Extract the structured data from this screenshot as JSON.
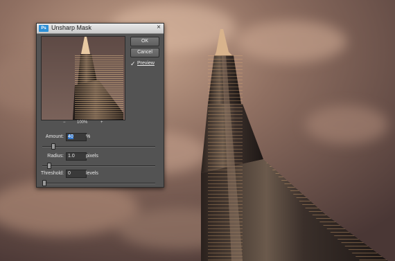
{
  "dialog": {
    "title": "Unsharp Mask",
    "icon_text": "Ps",
    "close_glyph": "×",
    "ok_label": "OK",
    "cancel_label": "Cancel",
    "preview_label": "Preview",
    "preview_checked": true,
    "check_glyph": "✓",
    "zoom_out_glyph": "−",
    "zoom_in_glyph": "+",
    "zoom_level": "100%"
  },
  "fields": {
    "amount": {
      "label": "Amount:",
      "value": "40",
      "unit": "%",
      "slider_fraction": 0.08
    },
    "radius": {
      "label": "Radius:",
      "value": "1.0",
      "unit": "pixels",
      "slider_fraction": 0.04
    },
    "threshold": {
      "label": "Threshold:",
      "value": "0",
      "unit": "levels",
      "slider_fraction": 0.0
    }
  },
  "icons": [
    "app-icon",
    "close-icon",
    "checkbox-icon",
    "zoom-out-icon",
    "zoom-in-icon"
  ],
  "colors": {
    "dialog_bg": "#535353",
    "accent": "#2d8fd6",
    "sky": "#8e6e60"
  }
}
